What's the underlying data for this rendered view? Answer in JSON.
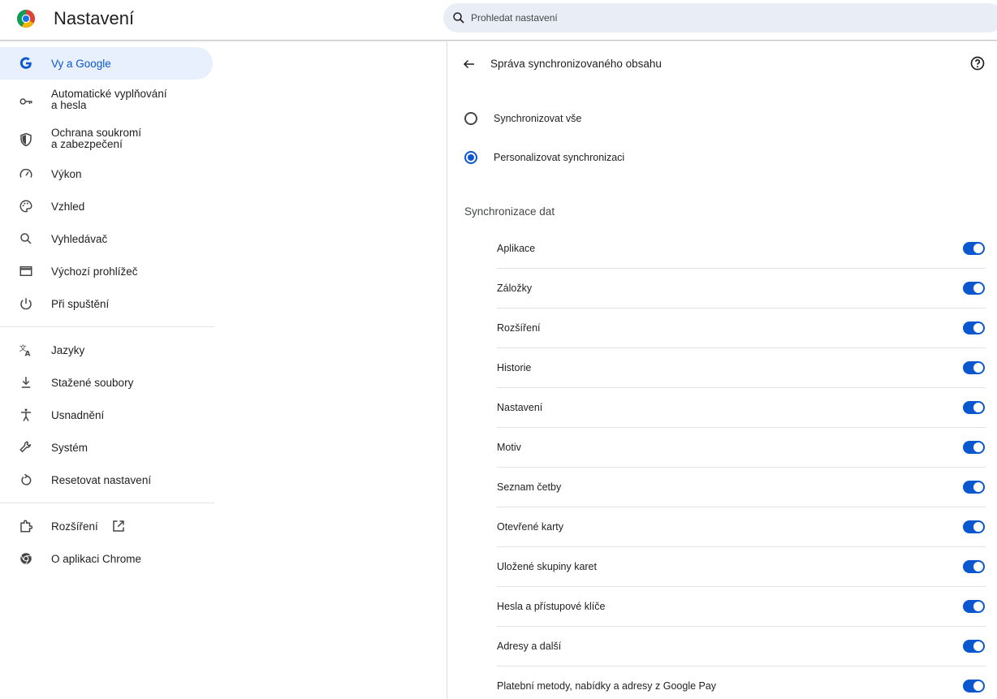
{
  "app": {
    "title": "Nastavení",
    "logo_icon": "chrome-logo-icon"
  },
  "search": {
    "placeholder": "Prohledat nastavení",
    "icon": "search-icon"
  },
  "sidebar": {
    "items": [
      {
        "label": "Vy a Google",
        "icon": "google-g-icon",
        "active": true
      },
      {
        "label": "Automatické vyplňování\na hesla",
        "icon": "key-icon"
      },
      {
        "label": "Ochrana soukromí\na zabezpečení",
        "icon": "shield-icon"
      },
      {
        "label": "Výkon",
        "icon": "speedometer-icon"
      },
      {
        "label": "Vzhled",
        "icon": "palette-icon"
      },
      {
        "label": "Vyhledávač",
        "icon": "search-icon"
      },
      {
        "label": "Výchozí prohlížeč",
        "icon": "browser-window-icon"
      },
      {
        "label": "Při spuštění",
        "icon": "power-icon"
      },
      {
        "label": "Jazyky",
        "icon": "translate-icon"
      },
      {
        "label": "Stažené soubory",
        "icon": "download-icon"
      },
      {
        "label": "Usnadnění",
        "icon": "accessibility-icon"
      },
      {
        "label": "Systém",
        "icon": "wrench-icon"
      },
      {
        "label": "Resetovat nastavení",
        "icon": "reset-icon"
      },
      {
        "label": "Rozšíření",
        "icon": "puzzle-icon",
        "external_icon": "open-in-new-icon"
      },
      {
        "label": "O aplikaci Chrome",
        "icon": "chrome-icon"
      }
    ]
  },
  "panel": {
    "title": "Správa synchronizovaného obsahu",
    "back_icon": "arrow-back-icon",
    "help_icon": "help-icon",
    "radios": [
      {
        "label": "Synchronizovat vše",
        "checked": false
      },
      {
        "label": "Personalizovat synchronizaci",
        "checked": true
      }
    ],
    "section_title": "Synchronizace dat",
    "toggles": [
      {
        "label": "Aplikace",
        "on": true
      },
      {
        "label": "Záložky",
        "on": true
      },
      {
        "label": "Rozšíření",
        "on": true
      },
      {
        "label": "Historie",
        "on": true
      },
      {
        "label": "Nastavení",
        "on": true
      },
      {
        "label": "Motiv",
        "on": true
      },
      {
        "label": "Seznam četby",
        "on": true
      },
      {
        "label": "Otevřené karty",
        "on": true
      },
      {
        "label": "Uložené skupiny karet",
        "on": true
      },
      {
        "label": "Hesla a přístupové klíče",
        "on": true
      },
      {
        "label": "Adresy a další",
        "on": true
      },
      {
        "label": "Platební metody, nabídky a adresy z Google Pay",
        "on": true
      }
    ]
  },
  "colors": {
    "accent": "#0b57d0",
    "active_bg": "#e8f0fe",
    "search_bg": "#e9eef6"
  }
}
